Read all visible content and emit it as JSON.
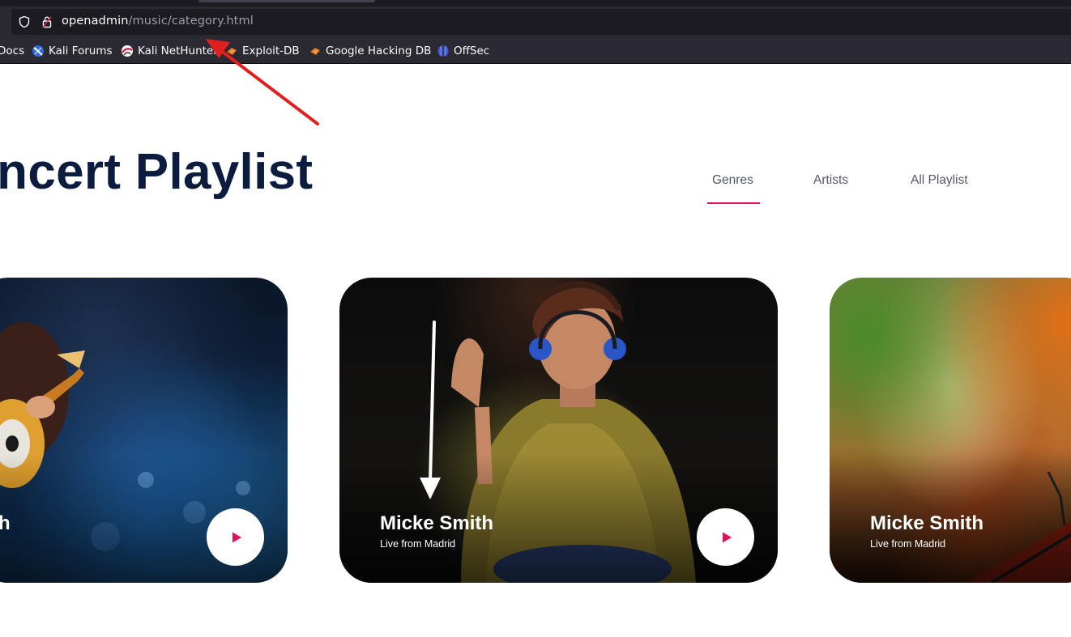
{
  "browser": {
    "url_host": "openadmin",
    "url_path": "/music/category.html",
    "bookmarks": [
      {
        "label": "Docs",
        "icon": "docs-icon"
      },
      {
        "label": "Kali Forums",
        "icon": "kali-forums-icon"
      },
      {
        "label": "Kali NetHunter",
        "icon": "kali-nethunter-icon"
      },
      {
        "label": "Exploit-DB",
        "icon": "exploit-db-icon"
      },
      {
        "label": "Google Hacking DB",
        "icon": "google-hacking-db-icon"
      },
      {
        "label": "OffSec",
        "icon": "offsec-icon"
      }
    ]
  },
  "page": {
    "title": "oncert Playlist",
    "tabs": [
      {
        "label": "Genres",
        "active": true
      },
      {
        "label": "Artists",
        "active": false
      },
      {
        "label": "All Playlist",
        "active": false
      }
    ],
    "cards": [
      {
        "title": "th",
        "subtitle": ""
      },
      {
        "title": "Micke Smith",
        "subtitle": "Live from Madrid"
      },
      {
        "title": "Micke Smith",
        "subtitle": "Live from Madrid"
      }
    ]
  },
  "colors": {
    "title": "#0b1c3f",
    "accent": "#e0115f",
    "annotation_arrow": "#e02020",
    "browser_bg": "#2b2a33"
  }
}
